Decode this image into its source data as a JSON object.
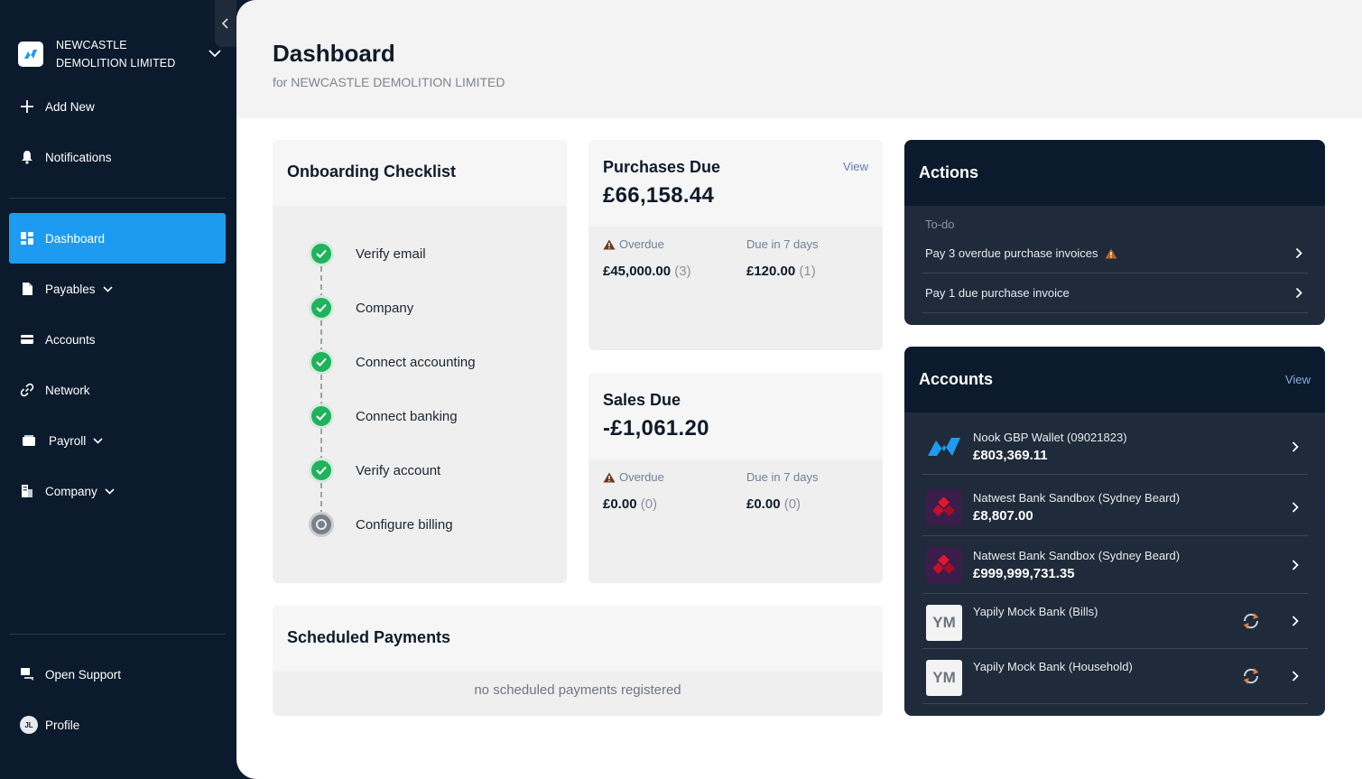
{
  "sidebar": {
    "org_line1": "NEWCASTLE",
    "org_line2": "DEMOLITION LIMITED",
    "add_new": "Add New",
    "notifications": "Notifications",
    "dashboard": "Dashboard",
    "payables": "Payables",
    "accounts": "Accounts",
    "network": "Network",
    "payroll": "Payroll",
    "company": "Company",
    "open_support": "Open Support",
    "profile": "Profile",
    "profile_initials": "JL"
  },
  "header": {
    "title": "Dashboard",
    "subtitle": "for NEWCASTLE DEMOLITION LIMITED"
  },
  "checklist": {
    "title": "Onboarding Checklist",
    "items": [
      {
        "label": "Verify email",
        "done": true
      },
      {
        "label": "Company",
        "done": true
      },
      {
        "label": "Connect accounting",
        "done": true
      },
      {
        "label": "Connect banking",
        "done": true
      },
      {
        "label": "Verify account",
        "done": true
      },
      {
        "label": "Configure billing",
        "done": false
      }
    ]
  },
  "purchases": {
    "title": "Purchases Due",
    "view": "View",
    "amount": "£66,158.44",
    "overdue_label": "Overdue",
    "overdue_amount": "£45,000.00",
    "overdue_count": "(3)",
    "due7_label": "Due in 7 days",
    "due7_amount": "£120.00",
    "due7_count": "(1)"
  },
  "sales": {
    "title": "Sales Due",
    "amount": "-£1,061.20",
    "overdue_label": "Overdue",
    "overdue_amount": "£0.00",
    "overdue_count": "(0)",
    "due7_label": "Due in 7 days",
    "due7_amount": "£0.00",
    "due7_count": "(0)"
  },
  "scheduled": {
    "title": "Scheduled Payments",
    "empty": "no scheduled payments registered"
  },
  "actions": {
    "title": "Actions",
    "todo_label": "To-do",
    "items": [
      {
        "label": "Pay 3 overdue purchase invoices",
        "warning": true
      },
      {
        "label": "Pay 1 due purchase invoice",
        "warning": false
      }
    ]
  },
  "accounts_panel": {
    "title": "Accounts",
    "view": "View",
    "items": [
      {
        "name": "Nook GBP Wallet (09021823)",
        "balance": "£803,369.11",
        "logo": "nook-logo"
      },
      {
        "name": "Natwest Bank Sandbox (Sydney Beard)",
        "balance": "£8,807.00",
        "logo": "natwest-logo"
      },
      {
        "name": "Natwest Bank Sandbox (Sydney Beard)",
        "balance": "£999,999,731.35",
        "logo": "natwest-logo"
      },
      {
        "name": "Yapily Mock Bank (Bills)",
        "balance": "",
        "logo_text": "YM"
      },
      {
        "name": "Yapily Mock Bank (Household)",
        "balance": "",
        "logo_text": "YM"
      }
    ]
  },
  "colors": {
    "sidebar_bg": "#0b1a2c",
    "active_nav": "#1d9bf0",
    "success": "#1fb35b",
    "link": "#5b7db3",
    "warning": "#b5651d",
    "natwest": "#5a1f5c"
  }
}
